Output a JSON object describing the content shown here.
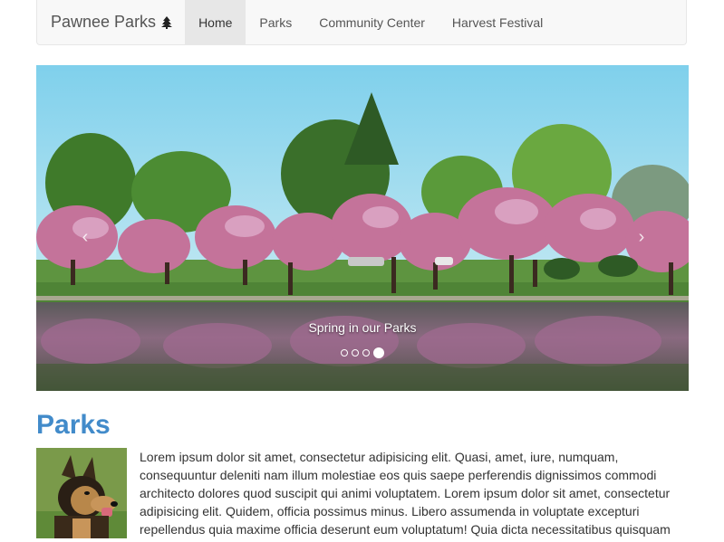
{
  "navbar": {
    "brand": "Pawnee Parks",
    "brand_icon": "tree-icon",
    "items": [
      {
        "label": "Home",
        "active": true
      },
      {
        "label": "Parks",
        "active": false
      },
      {
        "label": "Community Center",
        "active": false
      },
      {
        "label": "Harvest Festival",
        "active": false
      }
    ]
  },
  "carousel": {
    "caption": "Spring in our Parks",
    "slide_count": 4,
    "active_index": 3,
    "prev_icon": "chevron-left-icon",
    "next_icon": "chevron-right-icon"
  },
  "section": {
    "title": "Parks",
    "text": "Lorem ipsum dolor sit amet, consectetur adipisicing elit. Quasi, amet, iure, numquam, consequuntur deleniti nam illum molestiae eos quis saepe perferendis dignissimos commodi architecto dolores quod suscipit qui animi voluptatem. Lorem ipsum dolor sit amet, consectetur adipisicing elit. Quidem, officia possimus minus. Libero assumenda in voluptate excepturi repellendus quia maxime officia deserunt eum voluptatum! Quia dicta necessitatibus quisquam"
  },
  "colors": {
    "accent": "#428bca",
    "navbar_bg": "#f8f8f8",
    "navbar_active_bg": "#e7e7e7"
  }
}
